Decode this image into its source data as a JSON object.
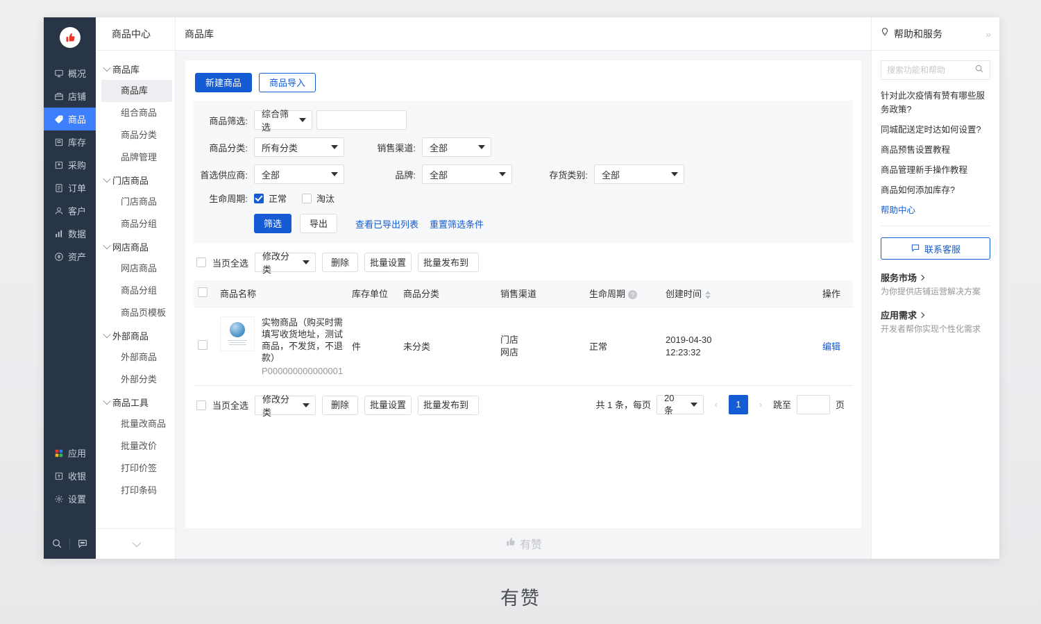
{
  "app": {
    "logo_icon": "thumbs-up-logo",
    "primary_nav": [
      {
        "label": "概况",
        "icon": "overview-icon",
        "active": false
      },
      {
        "label": "店铺",
        "icon": "shop-icon",
        "active": false
      },
      {
        "label": "商品",
        "icon": "tag-icon",
        "active": true
      },
      {
        "label": "库存",
        "icon": "inventory-icon",
        "active": false
      },
      {
        "label": "采购",
        "icon": "purchase-icon",
        "active": false
      },
      {
        "label": "订单",
        "icon": "order-icon",
        "active": false
      },
      {
        "label": "客户",
        "icon": "customer-icon",
        "active": false
      },
      {
        "label": "数据",
        "icon": "chart-icon",
        "active": false
      },
      {
        "label": "资产",
        "icon": "asset-icon",
        "active": false
      }
    ],
    "primary_nav_lower": [
      {
        "label": "应用",
        "icon": "apps-icon",
        "active": false
      },
      {
        "label": "收银",
        "icon": "cashier-icon",
        "active": false
      },
      {
        "label": "设置",
        "icon": "gear-icon",
        "active": false
      }
    ],
    "nav_bottom": [
      {
        "icon": "search-icon"
      },
      {
        "icon": "chat-icon"
      }
    ]
  },
  "second_nav": {
    "title": "商品中心",
    "groups": [
      {
        "title": "商品库",
        "items": [
          {
            "label": "商品库",
            "active": true
          },
          {
            "label": "组合商品",
            "active": false
          },
          {
            "label": "商品分类",
            "active": false
          },
          {
            "label": "品牌管理",
            "active": false
          }
        ]
      },
      {
        "title": "门店商品",
        "items": [
          {
            "label": "门店商品",
            "active": false
          },
          {
            "label": "商品分组",
            "active": false
          }
        ]
      },
      {
        "title": "网店商品",
        "items": [
          {
            "label": "网店商品",
            "active": false
          },
          {
            "label": "商品分组",
            "active": false
          },
          {
            "label": "商品页模板",
            "active": false
          }
        ]
      },
      {
        "title": "外部商品",
        "items": [
          {
            "label": "外部商品",
            "active": false
          },
          {
            "label": "外部分类",
            "active": false
          }
        ]
      },
      {
        "title": "商品工具",
        "items": [
          {
            "label": "批量改商品",
            "active": false
          },
          {
            "label": "批量改价",
            "active": false
          },
          {
            "label": "打印价签",
            "active": false
          },
          {
            "label": "打印条码",
            "active": false
          }
        ]
      }
    ],
    "collapse_icon": "chevron-down-icon"
  },
  "breadcrumb": "商品库",
  "toolbar": {
    "create_label": "新建商品",
    "import_label": "商品导入"
  },
  "filters": {
    "product_filter_label": "商品筛选:",
    "product_filter_value": "综合筛选",
    "keyword_value": "",
    "keyword_placeholder": "",
    "category_label": "商品分类:",
    "category_value": "所有分类",
    "channel_label": "销售渠道:",
    "channel_value": "全部",
    "supplier_label": "首选供应商:",
    "supplier_value": "全部",
    "brand_label": "品牌:",
    "brand_value": "全部",
    "stock_type_label": "存货类别:",
    "stock_type_value": "全部",
    "lifecycle_label": "生命周期:",
    "lifecycle_normal": "正常",
    "lifecycle_normal_checked": true,
    "lifecycle_obsolete": "淘汰",
    "lifecycle_obsolete_checked": false,
    "submit_label": "筛选",
    "export_label": "导出",
    "view_exported_label": "查看已导出列表",
    "reset_label": "重置筛选条件"
  },
  "batch_bar": {
    "select_all_label": "当页全选",
    "change_category_label": "修改分类",
    "delete_label": "删除",
    "batch_setting_label": "批量设置",
    "batch_publish_label": "批量发布到"
  },
  "table": {
    "columns": [
      "商品名称",
      "库存单位",
      "商品分类",
      "销售渠道",
      "生命周期",
      "创建时间",
      "操作"
    ],
    "lifecycle_help_icon": "question-mark-icon",
    "created_sort_icon": "sort-icon",
    "rows": [
      {
        "checked": false,
        "thumb_icon": "product-thumbnail",
        "name": "实物商品（购买时需填写收货地址，测试商品，不发货，不退款）",
        "code": "P000000000000001",
        "unit": "件",
        "category": "未分类",
        "channels": [
          "门店",
          "网店"
        ],
        "lifecycle": "正常",
        "created_date": "2019-04-30",
        "created_time": "12:23:32",
        "action_label": "编辑"
      }
    ]
  },
  "pagination": {
    "total_text": "共 1 条，每页",
    "page_size": "20 条",
    "prev_icon": "chevron-left-icon",
    "next_icon": "chevron-right-icon",
    "current_page": "1",
    "jump_label": "跳至",
    "jump_value": "",
    "page_unit": "页"
  },
  "app_footer": {
    "icon": "thumbs-up-icon",
    "text": "有赞"
  },
  "help": {
    "icon": "bulb-icon",
    "title": "帮助和服务",
    "collapse_icon": "double-chevron-right-icon",
    "search_placeholder": "搜索功能和帮助",
    "search_value": "",
    "search_icon": "search-icon",
    "links": [
      {
        "text": "针对此次疫情有赞有哪些服务政策?",
        "blue": false
      },
      {
        "text": "同城配送定时达如何设置?",
        "blue": false
      },
      {
        "text": "商品预售设置教程",
        "blue": false
      },
      {
        "text": "商品管理新手操作教程",
        "blue": false
      },
      {
        "text": "商品如何添加库存?",
        "blue": false
      },
      {
        "text": "帮助中心",
        "blue": true
      }
    ],
    "contact_icon": "chat-icon",
    "contact_label": "联系客服",
    "promos": [
      {
        "title": "服务市场",
        "sub": "为你提供店铺运营解决方案"
      },
      {
        "title": "应用需求",
        "sub": "开发者帮你实现个性化需求"
      }
    ]
  },
  "page_brand": "有赞",
  "colors": {
    "primary": "#155bd4",
    "nav_active": "#3d7fff",
    "sidebar_bg": "#283547",
    "page_bg": "#f4f5f7"
  }
}
